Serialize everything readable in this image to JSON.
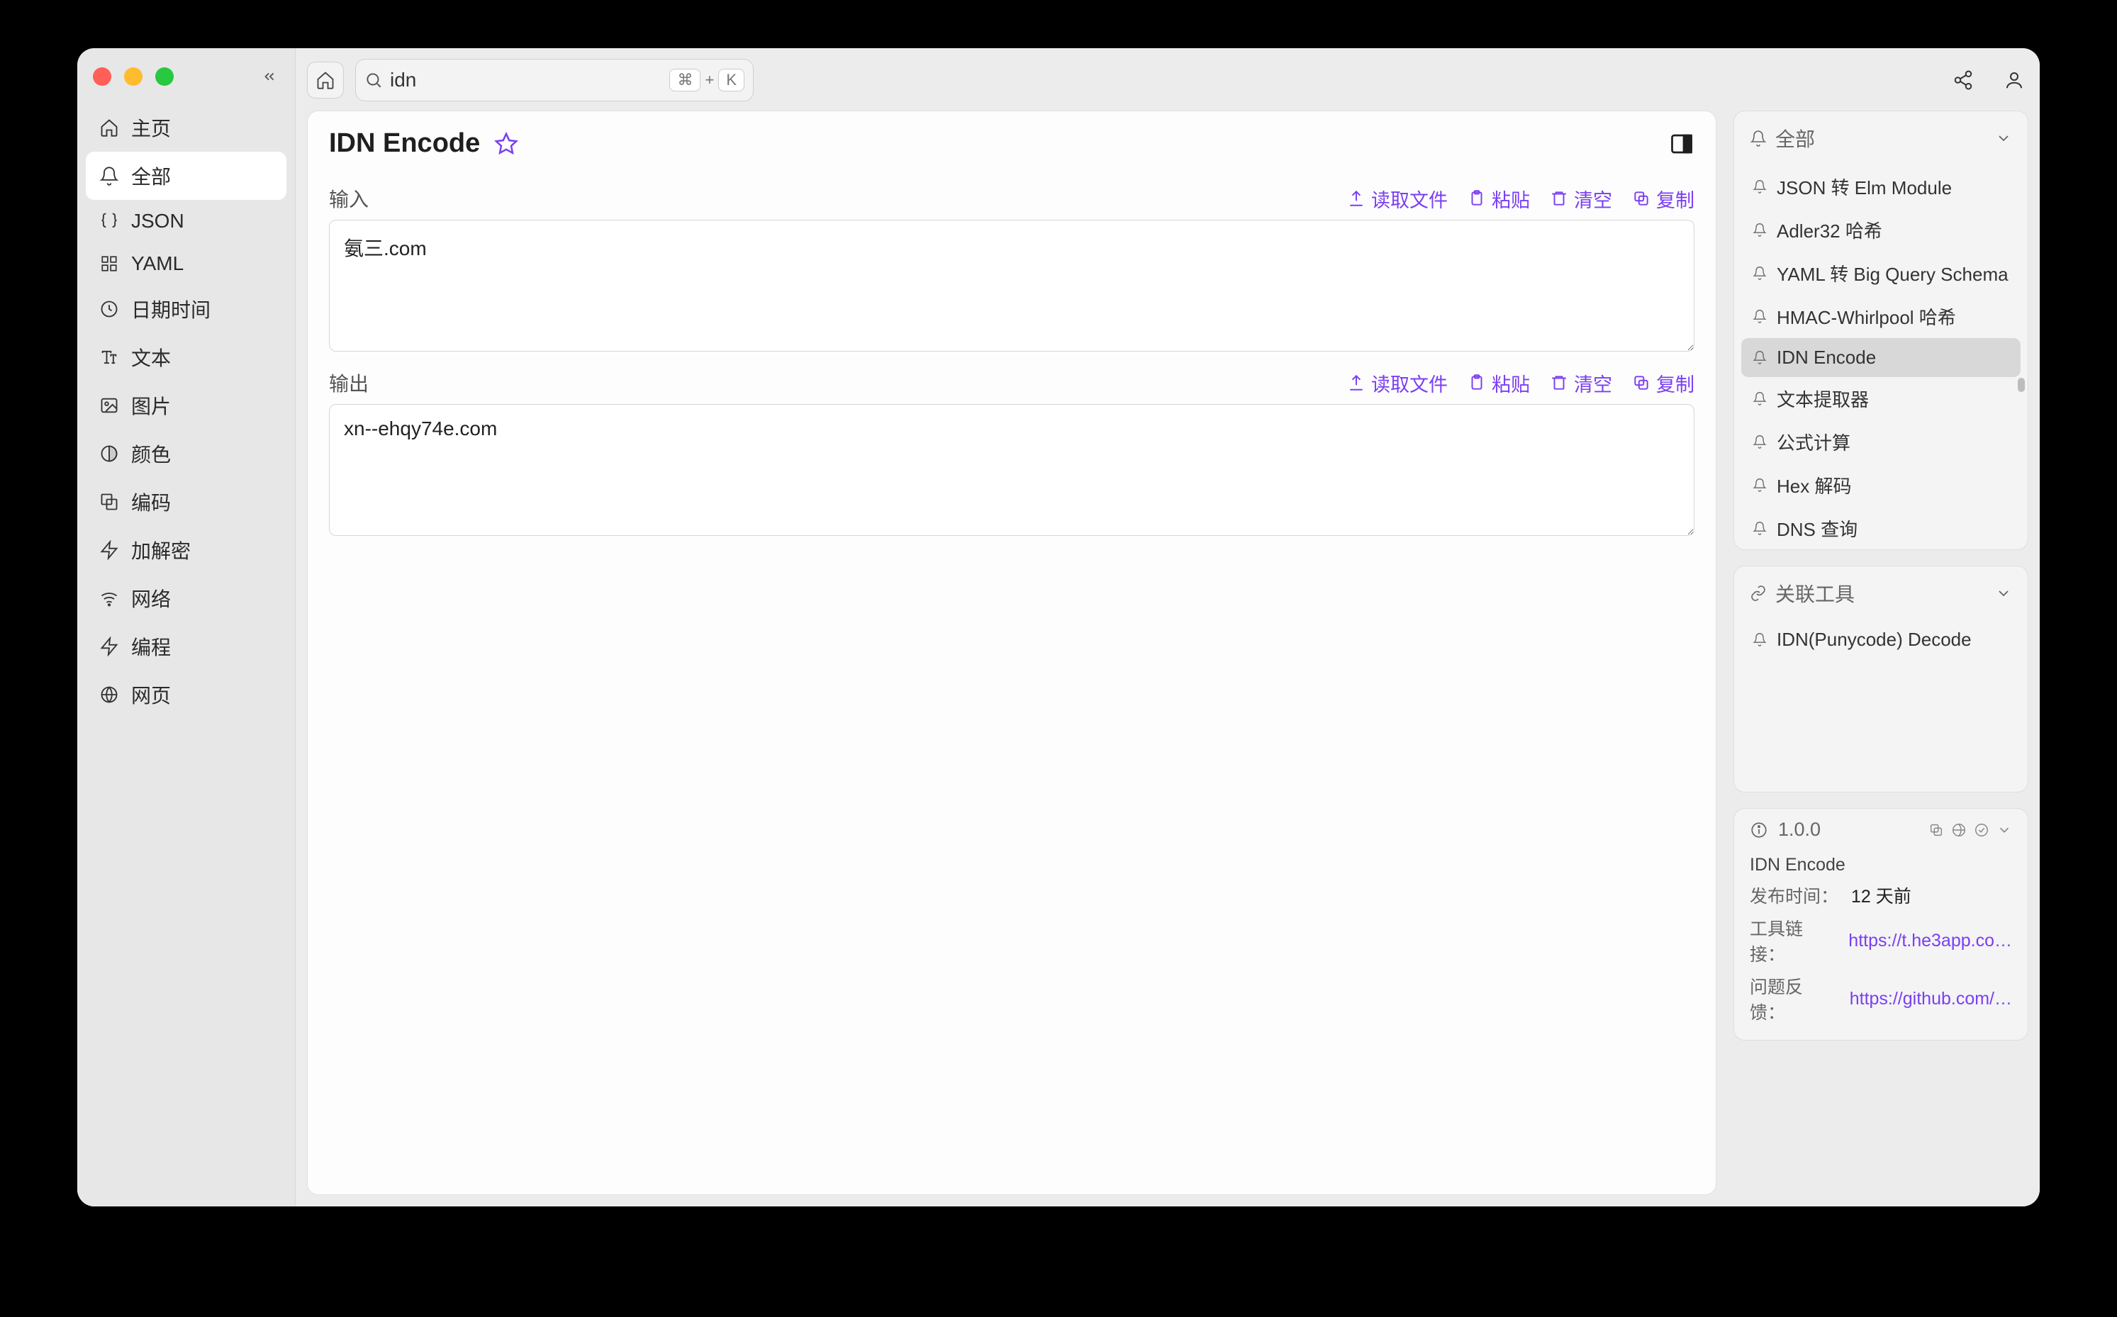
{
  "sidebar": {
    "items": [
      {
        "label": "主页"
      },
      {
        "label": "全部"
      },
      {
        "label": "JSON"
      },
      {
        "label": "YAML"
      },
      {
        "label": "日期时间"
      },
      {
        "label": "文本"
      },
      {
        "label": "图片"
      },
      {
        "label": "颜色"
      },
      {
        "label": "编码"
      },
      {
        "label": "加解密"
      },
      {
        "label": "网络"
      },
      {
        "label": "编程"
      },
      {
        "label": "网页"
      }
    ]
  },
  "topbar": {
    "search_value": "idn",
    "shortcut_mod": "⌘",
    "shortcut_plus": "+",
    "shortcut_key": "K"
  },
  "tool": {
    "title": "IDN Encode",
    "input_label": "输入",
    "output_label": "输出",
    "input_value": "氨三.com",
    "output_value": "xn--ehqy74e.com",
    "actions": {
      "read_file": "读取文件",
      "paste": "粘贴",
      "clear": "清空",
      "copy": "复制"
    }
  },
  "right": {
    "all_title": "全部",
    "related_title": "关联工具",
    "all_items": [
      {
        "label": "JSON 转 Elm Module"
      },
      {
        "label": "Adler32 哈希"
      },
      {
        "label": "YAML 转 Big Query Schema"
      },
      {
        "label": "HMAC-Whirlpool 哈希"
      },
      {
        "label": "IDN Encode",
        "active": true
      },
      {
        "label": "文本提取器"
      },
      {
        "label": "公式计算"
      },
      {
        "label": "Hex 解码"
      },
      {
        "label": "DNS 查询"
      }
    ],
    "related_items": [
      {
        "label": "IDN(Punycode) Decode"
      }
    ]
  },
  "info": {
    "version": "1.0.0",
    "name": "IDN Encode",
    "published_key": "发布时间：",
    "published_val": "12 天前",
    "link_key": "工具链接：",
    "link_val": "https://t.he3app.co…",
    "issue_key": "问题反馈：",
    "issue_val": "https://github.com/…"
  }
}
